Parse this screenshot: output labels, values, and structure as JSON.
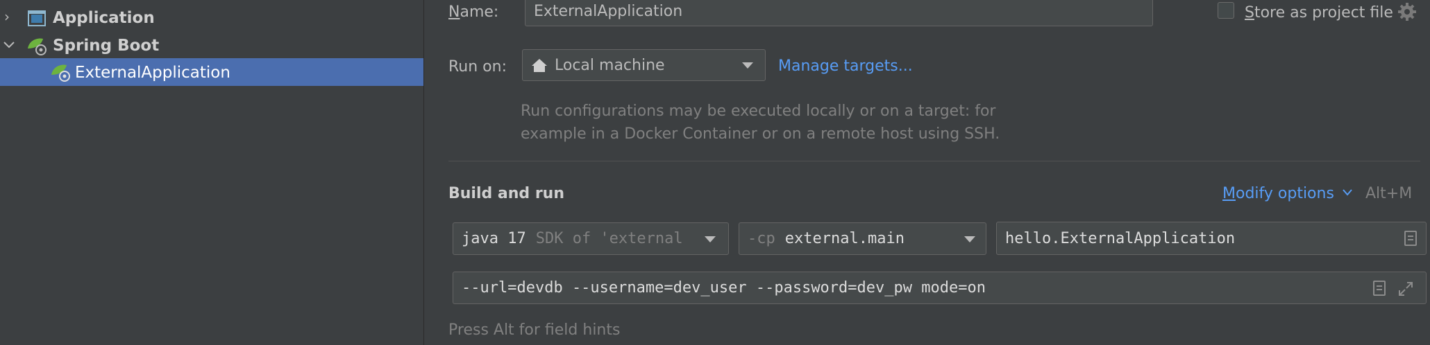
{
  "tree": {
    "items": [
      {
        "label": "Application"
      },
      {
        "label": "Spring Boot"
      },
      {
        "label": "ExternalApplication"
      }
    ]
  },
  "form": {
    "name_label_u": "N",
    "name_label_rest": "ame:",
    "name_value": "ExternalApplication",
    "store_u": "S",
    "store_rest": "tore as project file",
    "run_on_label": "Run on:",
    "run_on_value": "Local machine",
    "manage_targets": "Manage targets...",
    "run_on_help_1": "Run configurations may be executed locally or on a target: for",
    "run_on_help_2": "example in a Docker Container or on a remote host using SSH.",
    "build_and_run": "Build and run",
    "modify_u": "M",
    "modify_rest": "odify options",
    "modify_shortcut": "Alt+M",
    "jdk_main": "java 17",
    "jdk_hint": "SDK of 'external",
    "cp_prefix": "-cp",
    "cp_value": "external.main",
    "main_class": "hello.ExternalApplication",
    "program_args": "--url=devdb --username=dev_user --password=dev_pw mode=on",
    "field_hint": "Press Alt for field hints"
  },
  "colors": {
    "background": "#3c3f41",
    "selection": "#4b6eaf",
    "link": "#589df6",
    "spring_green": "#6db33f"
  }
}
